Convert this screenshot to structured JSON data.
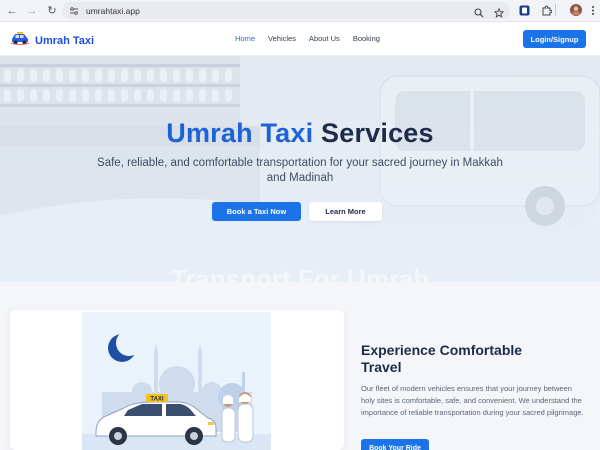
{
  "browser": {
    "url": "umrahtaxi.app"
  },
  "header": {
    "brand": "Umrah Taxi",
    "nav": [
      "Home",
      "Vehicles",
      "About Us",
      "Booking"
    ],
    "login_label": "Login/Signup"
  },
  "hero": {
    "title_part1": "Umrah Taxi",
    "title_part2": "Services",
    "subtitle": "Safe, reliable, and comfortable transportation for your sacred journey in Makkah and Madinah",
    "primary_button": "Book a Taxi Now",
    "secondary_button": "Learn More",
    "faded_heading": "Transport For Umrah"
  },
  "feature": {
    "title": "Experience Comfortable Travel",
    "text": "Our fleet of modern vehicles ensures that your journey between holy sites is comfortable, safe, and convenient. We understand the importance of reliable transportation during your sacred pilgrimage.",
    "button": "Book Your Ride",
    "taxi_sign": "TAXI"
  },
  "colors": {
    "primary": "#1a73e8",
    "brand": "#1d4ed8",
    "heading": "#1c2b47"
  }
}
